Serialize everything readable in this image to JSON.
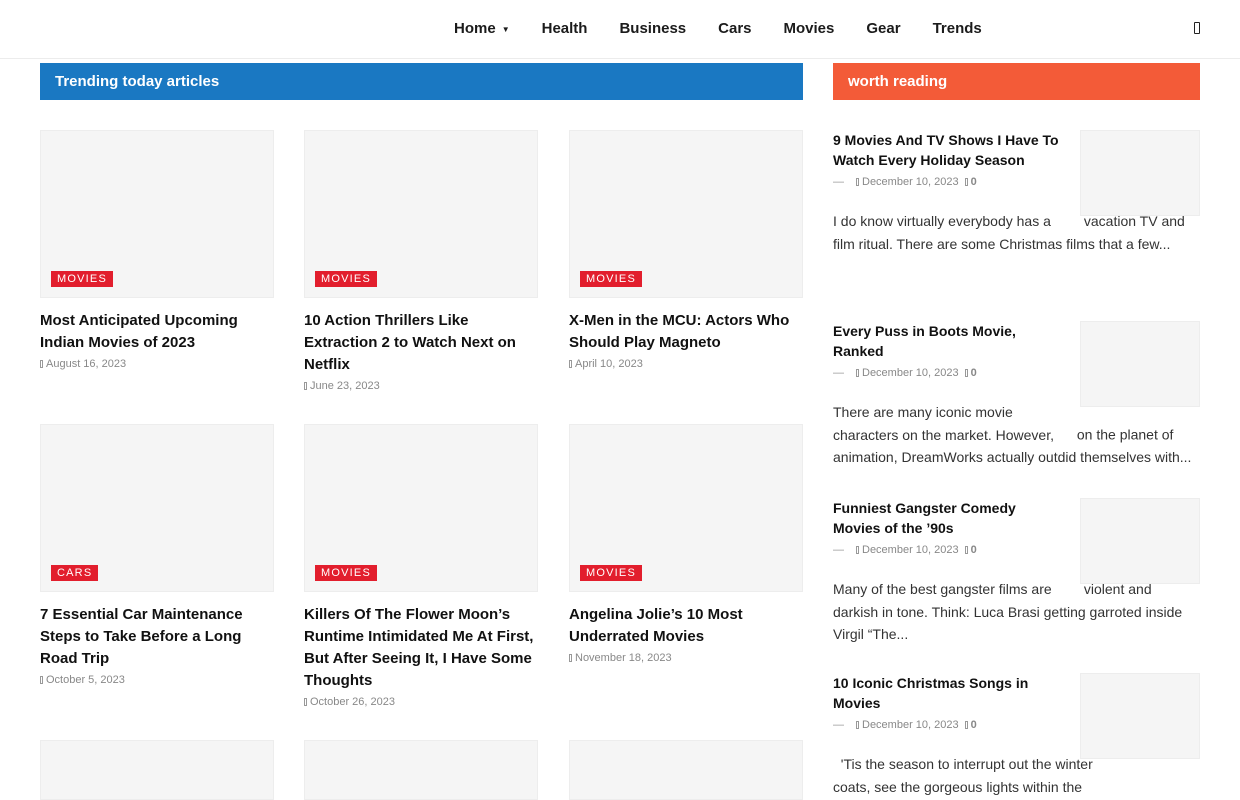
{
  "nav": {
    "items": [
      {
        "label": "Home",
        "has_dropdown": true
      },
      {
        "label": "Health"
      },
      {
        "label": "Business"
      },
      {
        "label": "Cars"
      },
      {
        "label": "Movies"
      },
      {
        "label": "Gear"
      },
      {
        "label": "Trends"
      }
    ],
    "search_icon": "search-icon"
  },
  "trending": {
    "heading": "Trending today articles",
    "color": "#1a78c2",
    "articles": [
      {
        "category": "MOVIES",
        "title": "Most Anticipated Upcoming Indian Movies of 2023",
        "date": "August 16, 2023"
      },
      {
        "category": "MOVIES",
        "title": "10 Action Thrillers Like Extraction 2 to Watch Next on Netflix",
        "date": "June 23, 2023"
      },
      {
        "category": "MOVIES",
        "title": "X-Men in the MCU: Actors Who Should Play Magneto",
        "date": "April 10, 2023"
      },
      {
        "category": "CARS",
        "title": "7 Essential Car Maintenance Steps to Take Before a Long Road Trip",
        "date": "October 5, 2023"
      },
      {
        "category": "MOVIES",
        "title": "Killers Of The Flower Moon’s Runtime Intimidated Me At First, But After Seeing It, I Have Some Thoughts",
        "date": "October 26, 2023"
      },
      {
        "category": "MOVIES",
        "title": "Angelina Jolie’s 10 Most Underrated Movies",
        "date": "November 18, 2023"
      }
    ]
  },
  "sidebar": {
    "heading": "worth reading",
    "color": "#f35b38",
    "dash": "—",
    "items": [
      {
        "title": "9 Movies And TV Shows I Have To Watch Every Holiday Season",
        "date": "December 10, 2023",
        "comments": "0",
        "excerpt_a": "I do know virtually everybody has a",
        "excerpt_b": "vacation TV and film ritual. There are some Christmas films that a few..."
      },
      {
        "title": "Every Puss in Boots Movie, Ranked",
        "date": "December 10, 2023",
        "comments": "0",
        "excerpt_a": "There are many iconic movie characters on the market. However,",
        "excerpt_b": "on the planet of animation, DreamWorks actually outdid themselves with..."
      },
      {
        "title": "Funniest Gangster Comedy Movies of the ’90s",
        "date": "December 10, 2023",
        "comments": "0",
        "excerpt_a": "Many of the best gangster films are",
        "excerpt_b": "violent and darkish in tone. Think: Luca Brasi getting garroted inside Virgil “The..."
      },
      {
        "title": "10 Iconic Christmas Songs in Movies",
        "date": "December 10, 2023",
        "comments": "0",
        "excerpt_a": "  'Tis the season to interrupt out the winter coats, see the gorgeous lights within the",
        "excerpt_b": ""
      }
    ]
  }
}
